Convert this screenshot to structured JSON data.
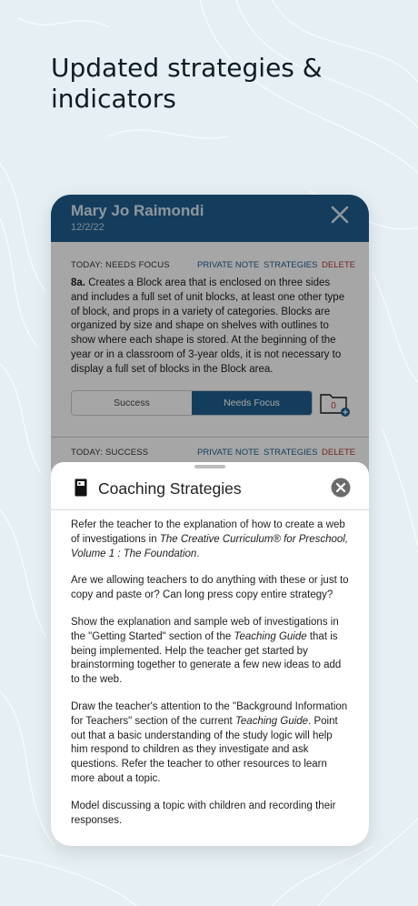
{
  "headline": "Updated strategies & indicators",
  "header": {
    "name": "Mary Jo Raimondi",
    "date": "12/2/22",
    "close_icon": "close-icon"
  },
  "indicator_1": {
    "status_label": "TODAY: NEEDS FOCUS",
    "private_note": "PRIVATE NOTE",
    "strategies": "STRATEGIES",
    "delete": "DELETE",
    "code": "8a.",
    "text": "Creates a Block area that is enclosed on three sides and includes a full set of unit blocks, at least one other type of block, and props in a variety of categories. Blocks are organized by size and shape on shelves with outlines to show where each shape is stored. At the beginning of the year or in a classroom of 3-year olds, it is not necessary to display a full set of blocks in the Block area.",
    "success_label": "Success",
    "needs_focus_label": "Needs Focus",
    "folder_count": "0"
  },
  "indicator_2": {
    "status_label": "TODAY: SUCCESS",
    "private_note": "PRIVATE NOTE",
    "strategies": "STRATEGIES",
    "delete": "DELETE"
  },
  "sheet": {
    "title": "Coaching Strategies",
    "p1_a": "Refer the teacher to the explanation of how to create a web of investigations in ",
    "p1_b": "The Creative Curriculum® for Preschool, Volume 1 : The Foundation",
    "p1_c": ".",
    "p2": "Are we allowing teachers to do anything with these or just to copy and paste or? Can long press copy entire strategy?",
    "p3_a": "Show the explanation and sample web of investigations in the \"Getting Started\" section of the ",
    "p3_b": "Teaching Guide",
    "p3_c": " that is being implemented. Help the teacher get started by brainstorming together to generate a few new ideas to add to the web.",
    "p4_a": "Draw the teacher's attention to the \"Background Information for Teachers\" section of the current ",
    "p4_b": "Teaching Guide",
    "p4_c": ". Point out that a basic understanding of the study logic will help him respond to children as they investigate and ask questions. Refer the teacher to other resources to learn more about a topic.",
    "p5": "Model discussing a topic with children and recording their responses."
  },
  "colors": {
    "header_blue": "#1f5e8f",
    "delete_red": "#b03a2e",
    "background": "#e6eff4"
  }
}
